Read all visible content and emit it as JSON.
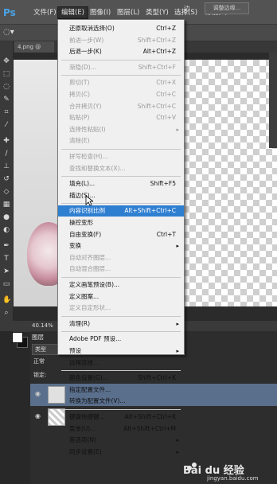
{
  "app": {
    "logo": "Ps"
  },
  "menubar": [
    {
      "label": "文件(F)",
      "active": false
    },
    {
      "label": "编辑(E)",
      "active": true
    },
    {
      "label": "图像(I)",
      "active": false
    },
    {
      "label": "图层(L)",
      "active": false
    },
    {
      "label": "类型(Y)",
      "active": false
    },
    {
      "label": "选择(S)",
      "active": false
    },
    {
      "label": "滤镜(T)",
      "active": false
    }
  ],
  "options": {
    "refine_edge": "调整边缘...",
    "tail_glyph": "边"
  },
  "document": {
    "tab": "4.png @"
  },
  "status": {
    "zoom": "40.14%"
  },
  "layers_panel": {
    "tab": "图层",
    "kind": "类型",
    "blend": "正常",
    "lock": "锁定:"
  },
  "edit_menu": {
    "items": [
      {
        "label": "还原取消选择(O)",
        "shortcut": "Ctrl+Z",
        "enabled": true
      },
      {
        "label": "前进一步(W)",
        "shortcut": "Shift+Ctrl+Z",
        "enabled": false
      },
      {
        "label": "后退一步(K)",
        "shortcut": "Alt+Ctrl+Z",
        "enabled": true
      },
      {
        "sep": true
      },
      {
        "label": "渐隐(D)...",
        "shortcut": "Shift+Ctrl+F",
        "enabled": false
      },
      {
        "sep": true
      },
      {
        "label": "剪切(T)",
        "shortcut": "Ctrl+X",
        "enabled": false
      },
      {
        "label": "拷贝(C)",
        "shortcut": "Ctrl+C",
        "enabled": false
      },
      {
        "label": "合并拷贝(Y)",
        "shortcut": "Shift+Ctrl+C",
        "enabled": false
      },
      {
        "label": "粘贴(P)",
        "shortcut": "Ctrl+V",
        "enabled": false
      },
      {
        "label": "选择性粘贴(I)",
        "shortcut": "",
        "enabled": false,
        "submenu": true
      },
      {
        "label": "清除(E)",
        "shortcut": "",
        "enabled": false
      },
      {
        "sep": true
      },
      {
        "label": "拼写检查(H)...",
        "shortcut": "",
        "enabled": false
      },
      {
        "label": "查找和替换文本(X)...",
        "shortcut": "",
        "enabled": false
      },
      {
        "sep": true
      },
      {
        "label": "填充(L)...",
        "shortcut": "Shift+F5",
        "enabled": true
      },
      {
        "label": "描边(S)...",
        "shortcut": "",
        "enabled": true
      },
      {
        "sep": true
      },
      {
        "label": "内容识别比例",
        "shortcut": "Alt+Shift+Ctrl+C",
        "enabled": true,
        "highlighted": true
      },
      {
        "label": "操控变形",
        "shortcut": "",
        "enabled": true
      },
      {
        "label": "自由变换(F)",
        "shortcut": "Ctrl+T",
        "enabled": true
      },
      {
        "label": "变换",
        "shortcut": "",
        "enabled": true,
        "submenu": true
      },
      {
        "label": "自动对齐图层...",
        "shortcut": "",
        "enabled": false
      },
      {
        "label": "自动混合图层...",
        "shortcut": "",
        "enabled": false
      },
      {
        "sep": true
      },
      {
        "label": "定义画笔预设(B)...",
        "shortcut": "",
        "enabled": true
      },
      {
        "label": "定义图案...",
        "shortcut": "",
        "enabled": true
      },
      {
        "label": "定义自定形状...",
        "shortcut": "",
        "enabled": false
      },
      {
        "sep": true
      },
      {
        "label": "清理(R)",
        "shortcut": "",
        "enabled": true,
        "submenu": true
      },
      {
        "sep": true
      },
      {
        "label": "Adobe PDF 预设...",
        "shortcut": "",
        "enabled": true
      },
      {
        "label": "预设",
        "shortcut": "",
        "enabled": true,
        "submenu": true
      },
      {
        "label": "远程连接...",
        "shortcut": "",
        "enabled": true
      },
      {
        "sep": true
      },
      {
        "label": "颜色设置(G)...",
        "shortcut": "Shift+Ctrl+K",
        "enabled": true
      },
      {
        "label": "指定配置文件...",
        "shortcut": "",
        "enabled": true
      },
      {
        "label": "转换为配置文件(V)...",
        "shortcut": "",
        "enabled": true
      },
      {
        "sep": true
      },
      {
        "label": "键盘快捷键...",
        "shortcut": "Alt+Shift+Ctrl+K",
        "enabled": true
      },
      {
        "label": "菜单(U)...",
        "shortcut": "Alt+Shift+Ctrl+M",
        "enabled": true
      },
      {
        "label": "首选项(N)",
        "shortcut": "",
        "enabled": true,
        "submenu": true
      },
      {
        "label": "同步设置(E)",
        "shortcut": "",
        "enabled": true,
        "submenu": true
      }
    ]
  },
  "watermark": {
    "brand": "Bai du 经验",
    "sub": "jingyan.baidu.com"
  },
  "colors": {
    "highlight": "#2f7fd1",
    "menu_bg": "#f0f0f0",
    "ui_dark": "#282828"
  }
}
